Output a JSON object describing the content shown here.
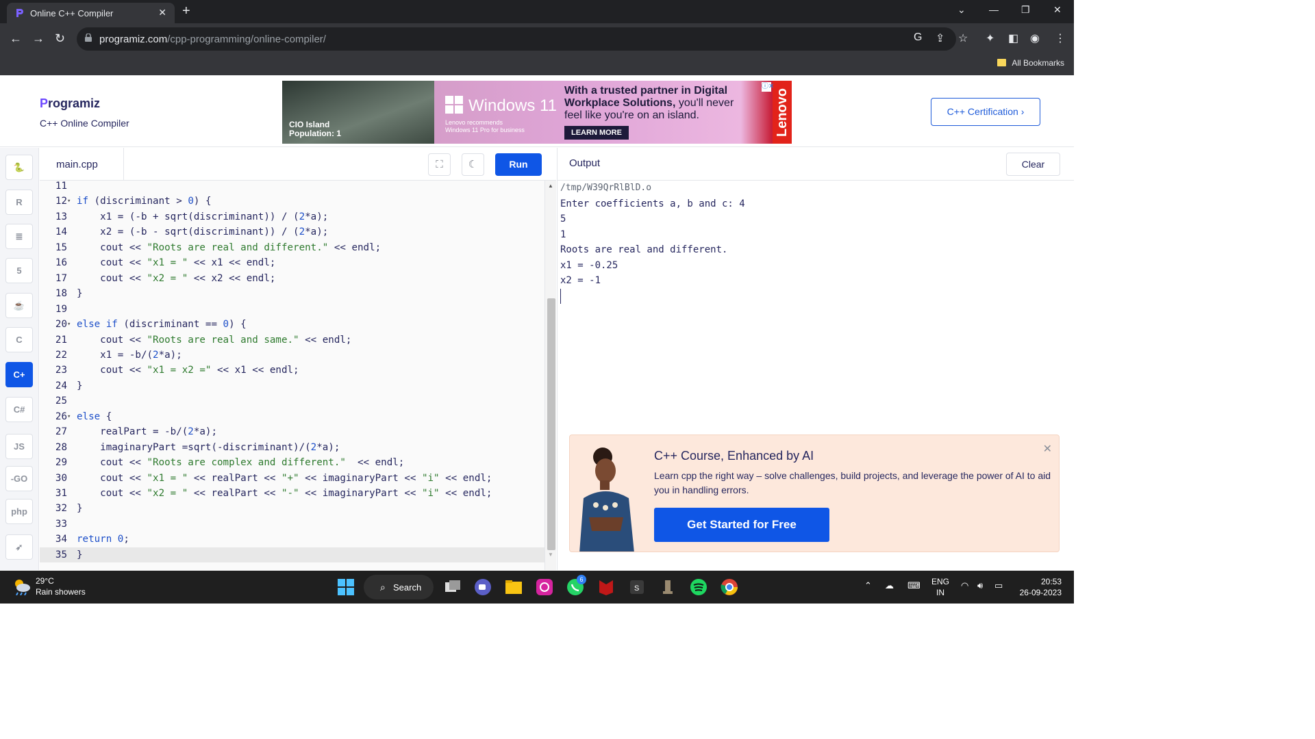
{
  "browser": {
    "tab_title": "Online C++ Compiler",
    "url_host": "programiz.com",
    "url_path": "/cpp-programming/online-compiler/",
    "bookmarks_label": "All Bookmarks"
  },
  "header": {
    "logo_text": "rogramiz",
    "logo_p": "P",
    "subtitle": "C++ Online Compiler",
    "cert_button": "C++ Certification ›",
    "ad": {
      "cio": "CIO Island\nPopulation: 1",
      "windows": "Windows 11",
      "lenovo_recommends": "Lenovo recommends\nWindows 11 Pro for business",
      "headline_bold": "With a trusted partner in Digital Workplace Solutions,",
      "headline_rest": " you'll never feel like you're on an island.",
      "cta": "LEARN MORE",
      "brand": "Lenovo"
    }
  },
  "sidebar": {
    "languages": [
      {
        "name": "python",
        "glyph": "🐍"
      },
      {
        "name": "r",
        "glyph": "R"
      },
      {
        "name": "sql",
        "glyph": "≣"
      },
      {
        "name": "html",
        "glyph": "5"
      },
      {
        "name": "java",
        "glyph": "☕"
      },
      {
        "name": "c",
        "glyph": "C"
      },
      {
        "name": "cpp",
        "glyph": "C+"
      },
      {
        "name": "csharp",
        "glyph": "C#"
      },
      {
        "name": "js",
        "glyph": "JS"
      },
      {
        "name": "go",
        "glyph": "-GO"
      },
      {
        "name": "php",
        "glyph": "php"
      },
      {
        "name": "swift",
        "glyph": "➶"
      }
    ]
  },
  "editor": {
    "filename": "main.cpp",
    "run_label": "Run",
    "lines": [
      {
        "n": "11",
        "fold": "",
        "html": ""
      },
      {
        "n": "12",
        "fold": "▾",
        "html": "<span class='kw'>if</span> (discriminant &gt; <span class='num'>0</span>) {"
      },
      {
        "n": "13",
        "fold": "",
        "html": "    x1 = (-b + sqrt(discriminant)) / (<span class='num'>2</span>*a);"
      },
      {
        "n": "14",
        "fold": "",
        "html": "    x2 = (-b - sqrt(discriminant)) / (<span class='num'>2</span>*a);"
      },
      {
        "n": "15",
        "fold": "",
        "html": "    cout &lt;&lt; <span class='str'>\"Roots are real and different.\"</span> &lt;&lt; endl;"
      },
      {
        "n": "16",
        "fold": "",
        "html": "    cout &lt;&lt; <span class='str'>\"x1 = \"</span> &lt;&lt; x1 &lt;&lt; endl;"
      },
      {
        "n": "17",
        "fold": "",
        "html": "    cout &lt;&lt; <span class='str'>\"x2 = \"</span> &lt;&lt; x2 &lt;&lt; endl;"
      },
      {
        "n": "18",
        "fold": "",
        "html": "}"
      },
      {
        "n": "19",
        "fold": "",
        "html": ""
      },
      {
        "n": "20",
        "fold": "▾",
        "html": "<span class='kw'>else if</span> (discriminant == <span class='num'>0</span>) {"
      },
      {
        "n": "21",
        "fold": "",
        "html": "    cout &lt;&lt; <span class='str'>\"Roots are real and same.\"</span> &lt;&lt; endl;"
      },
      {
        "n": "22",
        "fold": "",
        "html": "    x1 = -b/(<span class='num'>2</span>*a);"
      },
      {
        "n": "23",
        "fold": "",
        "html": "    cout &lt;&lt; <span class='str'>\"x1 = x2 =\"</span> &lt;&lt; x1 &lt;&lt; endl;"
      },
      {
        "n": "24",
        "fold": "",
        "html": "}"
      },
      {
        "n": "25",
        "fold": "",
        "html": ""
      },
      {
        "n": "26",
        "fold": "▾",
        "html": "<span class='kw'>else</span> {"
      },
      {
        "n": "27",
        "fold": "",
        "html": "    realPart = -b/(<span class='num'>2</span>*a);"
      },
      {
        "n": "28",
        "fold": "",
        "html": "    imaginaryPart =sqrt(-discriminant)/(<span class='num'>2</span>*a);"
      },
      {
        "n": "29",
        "fold": "",
        "html": "    cout &lt;&lt; <span class='str'>\"Roots are complex and different.\"</span>  &lt;&lt; endl;"
      },
      {
        "n": "30",
        "fold": "",
        "html": "    cout &lt;&lt; <span class='str'>\"x1 = \"</span> &lt;&lt; realPart &lt;&lt; <span class='str'>\"+\"</span> &lt;&lt; imaginaryPart &lt;&lt; <span class='str'>\"i\"</span> &lt;&lt; endl;"
      },
      {
        "n": "31",
        "fold": "",
        "html": "    cout &lt;&lt; <span class='str'>\"x2 = \"</span> &lt;&lt; realPart &lt;&lt; <span class='str'>\"-\"</span> &lt;&lt; imaginaryPart &lt;&lt; <span class='str'>\"i\"</span> &lt;&lt; endl;"
      },
      {
        "n": "32",
        "fold": "",
        "html": "}"
      },
      {
        "n": "33",
        "fold": "",
        "html": ""
      },
      {
        "n": "34",
        "fold": "",
        "html": "<span class='kw'>return</span> <span class='num'>0</span>;"
      },
      {
        "n": "35",
        "fold": "",
        "html": "}"
      }
    ]
  },
  "output": {
    "title": "Output",
    "clear_label": "Clear",
    "lines": [
      "/tmp/W39QrRlBlD.o",
      "Enter coefficients a, b and c: 4",
      "5",
      "1",
      "Roots are real and different.",
      "x1 = -0.25",
      "x2 = -1"
    ]
  },
  "promo": {
    "title": "C++ Course, Enhanced by AI",
    "description": "Learn cpp the right way – solve challenges, build projects, and leverage the power of AI to aid you in handling errors.",
    "button": "Get Started for Free"
  },
  "taskbar": {
    "temperature": "29°C",
    "weather": "Rain showers",
    "search_label": "Search",
    "whatsapp_badge": "6",
    "lang_line1": "ENG",
    "lang_line2": "IN",
    "time": "20:53",
    "date": "26-09-2023"
  },
  "colors": {
    "accent": "#0f56e6",
    "brand_navy": "#25265e",
    "chrome_dark": "#202124"
  }
}
